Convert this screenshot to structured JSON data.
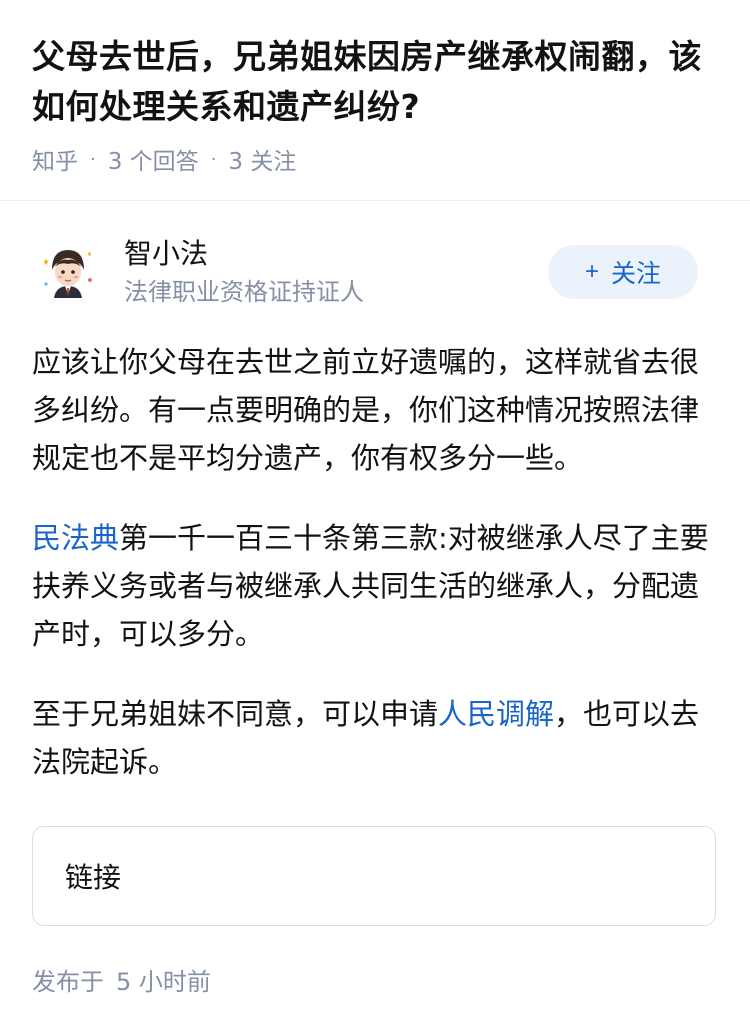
{
  "question": {
    "title": "父母去世后，兄弟姐妹因房产继承权闹翻，该如何处理关系和遗产纠纷?",
    "source": "知乎",
    "answers": "3 个回答",
    "followers": "3 关注"
  },
  "author": {
    "name": "智小法",
    "description": "法律职业资格证持证人",
    "follow_label": "关注",
    "follow_icon": "plus-icon"
  },
  "answer": {
    "p1": "应该让你父母在去世之前立好遗嘱的，这样就省去很多纠纷。有一点要明确的是，你们这种情况按照法律规定也不是平均分遗产，你有权多分一些。",
    "p2_link": "民法典",
    "p2_text": "第一千一百三十条第三款:对被继承人尽了主要扶养义务或者与被继承人共同生活的继承人，分配遗产时，可以多分。",
    "p3_before": "至于兄弟姐妹不同意，可以申请",
    "p3_link": "人民调解",
    "p3_after": "，也可以去法院起诉。"
  },
  "link_card": {
    "label": "链接"
  },
  "footer": {
    "publish_prefix": "发布于",
    "publish_time": "5 小时前"
  },
  "colors": {
    "accent": "#1a66c8",
    "meta": "#8590a6",
    "follow_bg": "#ebf2fb"
  }
}
